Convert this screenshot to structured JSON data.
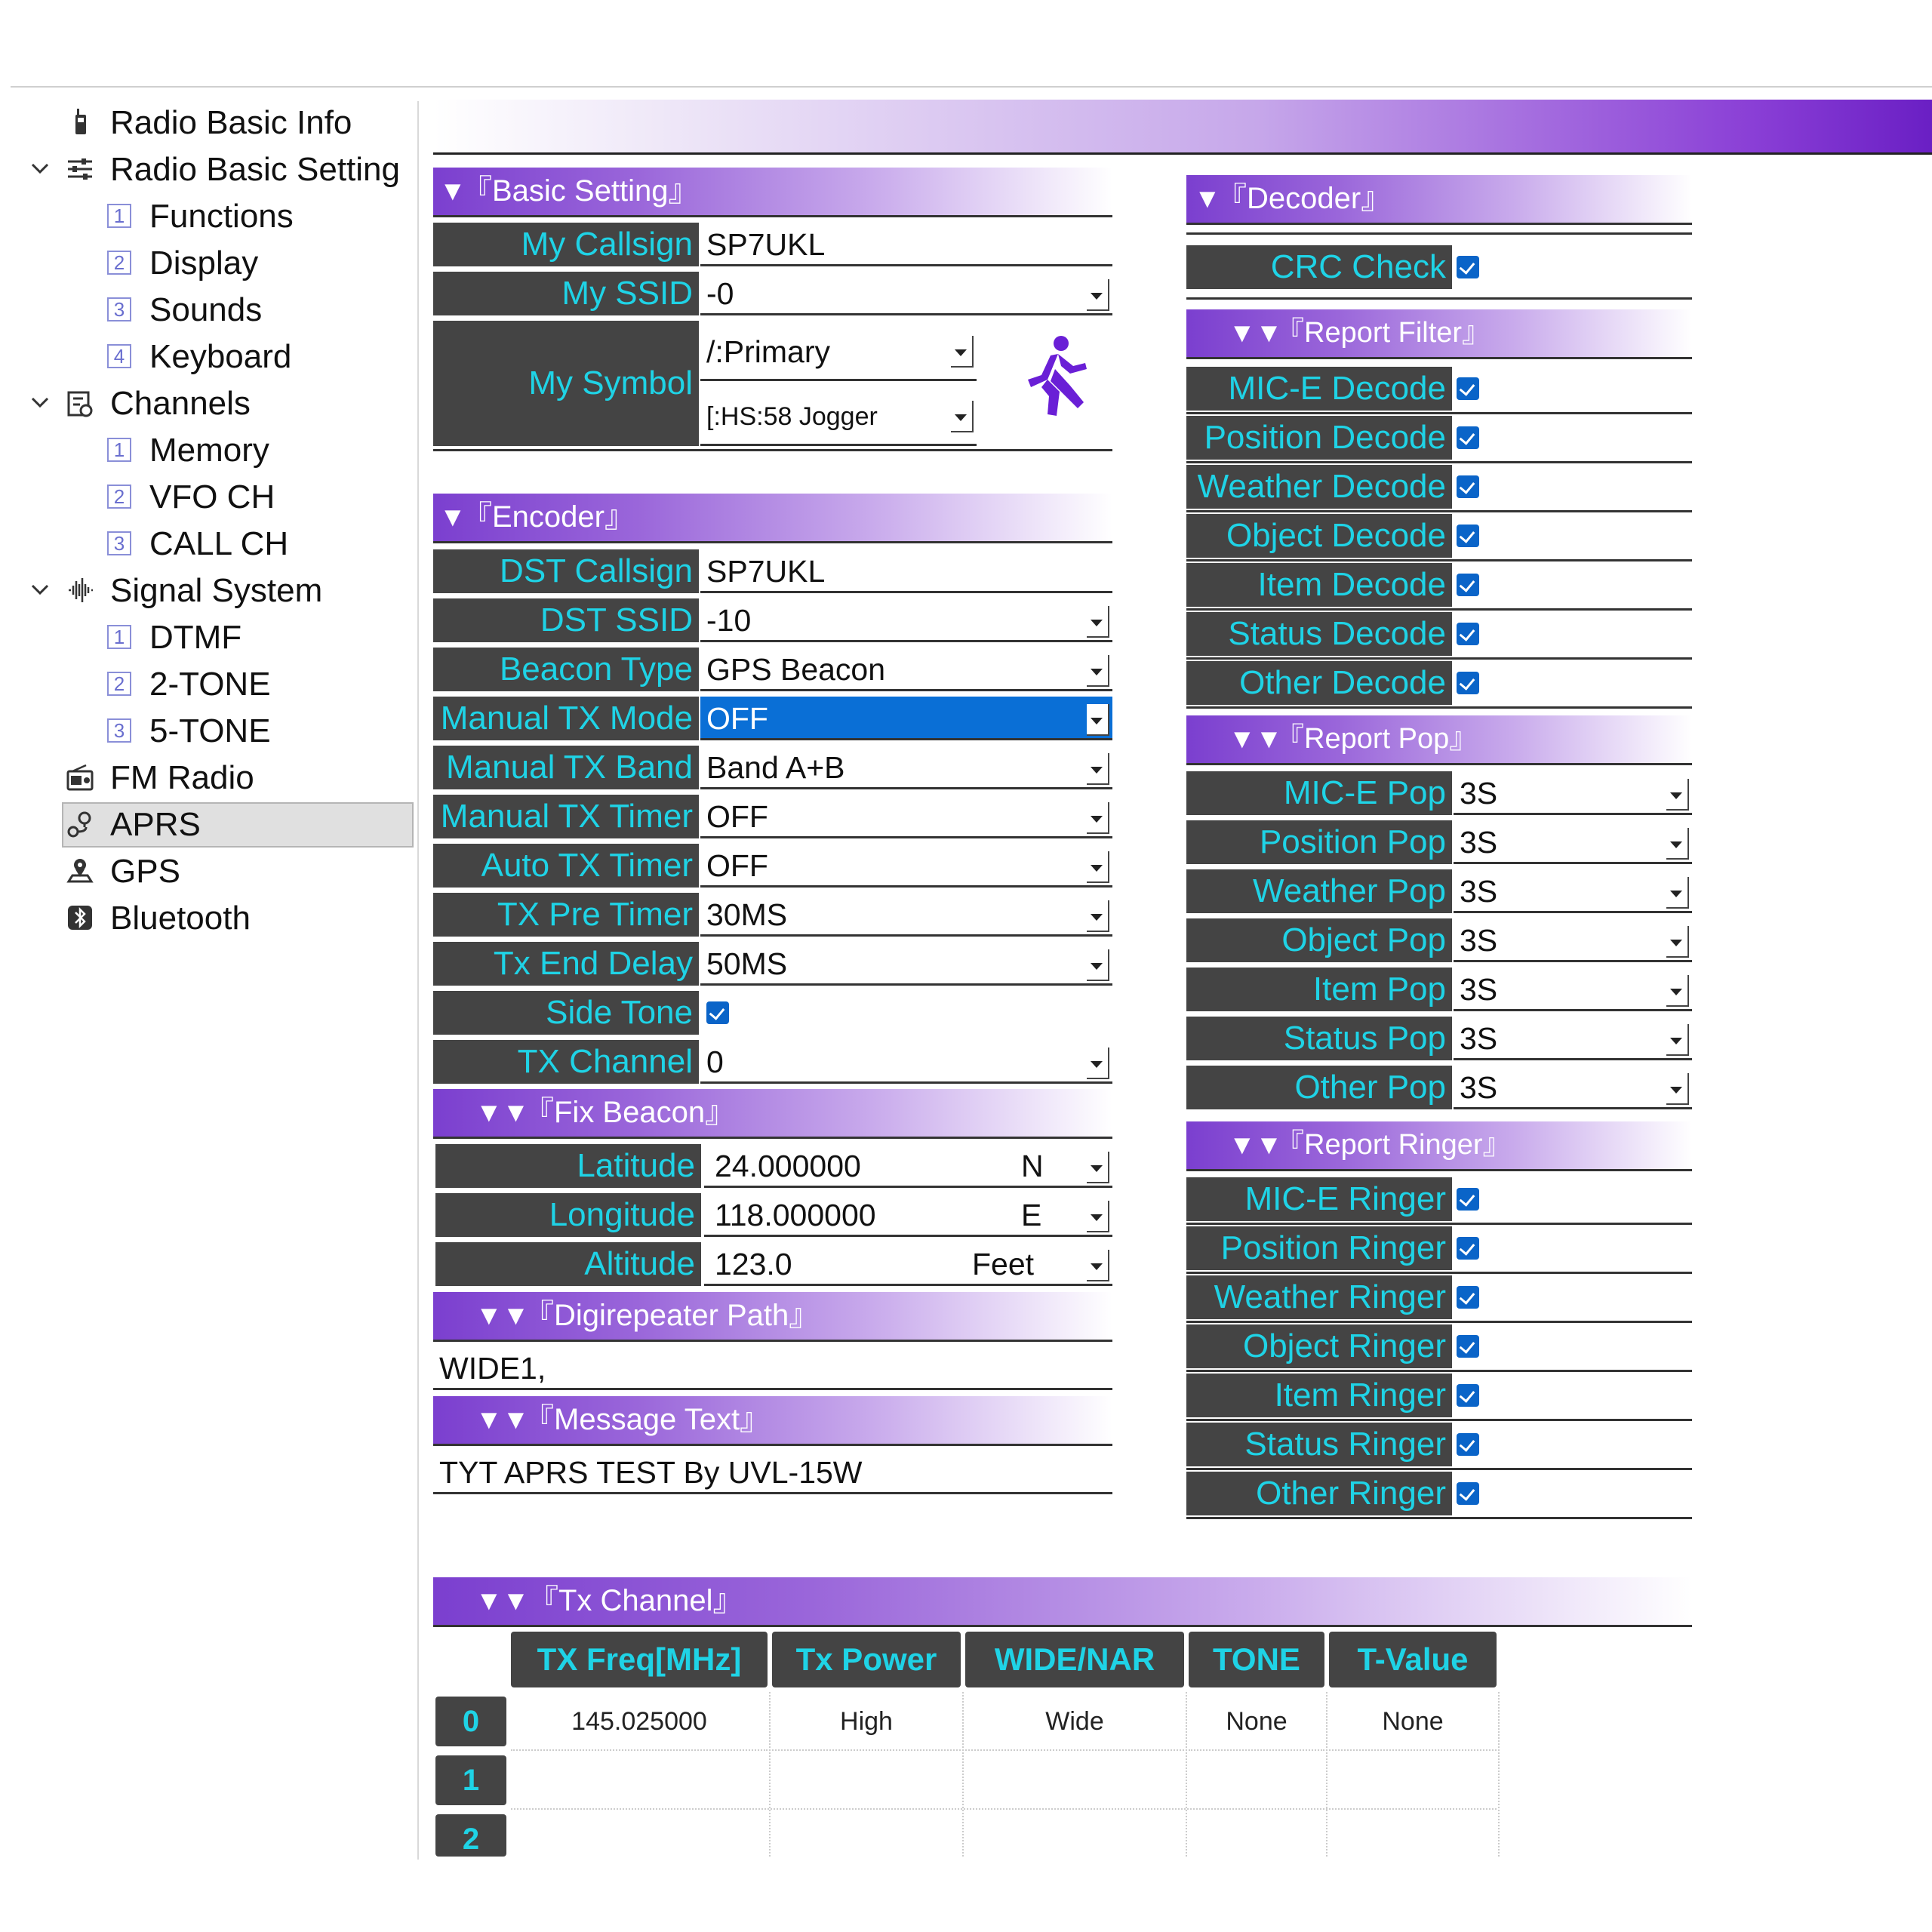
{
  "sidebar": {
    "items": [
      {
        "label": "Radio Basic Info",
        "icon": "radio-icon"
      },
      {
        "label": "Radio Basic Setting",
        "icon": "sliders-icon"
      },
      {
        "num": "1",
        "label": "Functions"
      },
      {
        "num": "2",
        "label": "Display"
      },
      {
        "num": "3",
        "label": "Sounds"
      },
      {
        "num": "4",
        "label": "Keyboard"
      },
      {
        "label": "Channels",
        "icon": "channels-icon"
      },
      {
        "num": "1",
        "label": "Memory"
      },
      {
        "num": "2",
        "label": "VFO CH"
      },
      {
        "num": "3",
        "label": "CALL CH"
      },
      {
        "label": "Signal System",
        "icon": "signal-icon"
      },
      {
        "num": "1",
        "label": "DTMF"
      },
      {
        "num": "2",
        "label": "2-TONE"
      },
      {
        "num": "3",
        "label": "5-TONE"
      },
      {
        "label": "FM Radio",
        "icon": "fm-radio-icon"
      },
      {
        "label": "APRS",
        "icon": "aprs-icon"
      },
      {
        "label": "GPS",
        "icon": "gps-icon"
      },
      {
        "label": "Bluetooth",
        "icon": "bluetooth-icon"
      }
    ]
  },
  "basic": {
    "title": "『Basic Setting』",
    "callsign_label": "My Callsign",
    "callsign": "SP7UKL",
    "ssid_label": "My SSID",
    "ssid": "-0",
    "symbol_label": "My Symbol",
    "symbol_table": "/:Primary",
    "symbol": "[:HS:58 Jogger"
  },
  "encoder": {
    "title": "『Encoder』",
    "rows": [
      {
        "label": "DST Callsign",
        "value": "SP7UKL"
      },
      {
        "label": "DST SSID",
        "value": "-10"
      },
      {
        "label": "Beacon Type",
        "value": "GPS Beacon"
      },
      {
        "label": "Manual TX Mode",
        "value": "OFF"
      },
      {
        "label": "Manual TX Band",
        "value": "Band A+B"
      },
      {
        "label": "Manual TX Timer",
        "value": "OFF"
      },
      {
        "label": "Auto TX Timer",
        "value": "OFF"
      },
      {
        "label": "TX Pre Timer",
        "value": "30MS"
      },
      {
        "label": "Tx End Delay",
        "value": "50MS"
      },
      {
        "label": "Side Tone",
        "value": ""
      },
      {
        "label": "TX Channel",
        "value": "0"
      }
    ]
  },
  "fix": {
    "title": "『Fix Beacon』",
    "lat_label": "Latitude",
    "lat": "24.000000",
    "lat_dir": "N",
    "lon_label": "Longitude",
    "lon": "118.000000",
    "lon_dir": "E",
    "alt_label": "Altitude",
    "alt": "123.0",
    "alt_unit": "Feet"
  },
  "digi": {
    "title": "『Digirepeater Path』",
    "value": "WIDE1,"
  },
  "message": {
    "title": "『Message Text』",
    "value": "TYT APRS TEST By UVL-15W"
  },
  "decoder": {
    "title": "『Decoder』",
    "crc_label": "CRC Check"
  },
  "filter": {
    "title": "『Report Filter』",
    "rows": [
      "MIC-E Decode",
      "Position Decode",
      "Weather Decode",
      "Object Decode",
      "Item Decode",
      "Status Decode",
      "Other Decode"
    ]
  },
  "pop": {
    "title": "『Report Pop』",
    "rows": [
      {
        "label": "MIC-E Pop",
        "value": "3S"
      },
      {
        "label": "Position Pop",
        "value": "3S"
      },
      {
        "label": "Weather Pop",
        "value": "3S"
      },
      {
        "label": "Object Pop",
        "value": "3S"
      },
      {
        "label": "Item Pop",
        "value": "3S"
      },
      {
        "label": "Status Pop",
        "value": "3S"
      },
      {
        "label": "Other Pop",
        "value": "3S"
      }
    ]
  },
  "ringer": {
    "title": "『Report Ringer』",
    "rows": [
      "MIC-E Ringer",
      "Position Ringer",
      "Weather Ringer",
      "Object Ringer",
      "Item Ringer",
      "Status Ringer",
      "Other Ringer"
    ]
  },
  "txchan": {
    "title": "『Tx Channel』",
    "headers": [
      "TX Freq[MHz]",
      "Tx Power",
      "WIDE/NAR",
      "TONE",
      "T-Value"
    ],
    "row_numbers": [
      "0",
      "1",
      "2"
    ],
    "rows": [
      [
        "145.025000",
        "High",
        "Wide",
        "None",
        "None"
      ]
    ]
  },
  "colors": {
    "label_text": "#1fd3e6",
    "label_bg": "#444444",
    "accent": "#7b3fcf",
    "selected": "#0a6fd6"
  }
}
